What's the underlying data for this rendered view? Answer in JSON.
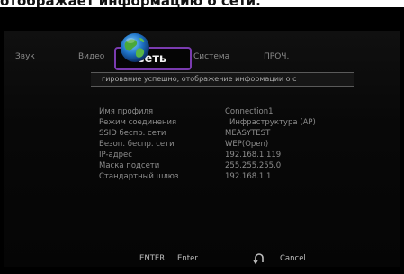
{
  "caption": "отображает информацию о сети.",
  "tabs": [
    {
      "label": "Звук"
    },
    {
      "label": "Видео"
    },
    {
      "label": "Сеть"
    },
    {
      "label": "Система"
    },
    {
      "label": "ПРОЧ."
    }
  ],
  "banner": {
    "text": "гирование успешно, отображение информации о с"
  },
  "info": {
    "rows": [
      {
        "label": "Имя профиля",
        "value": "Connection1"
      },
      {
        "label": "Режим соединения",
        "value": "Инфраструктура (AP)"
      },
      {
        "label": "SSID беспр. сети",
        "value": "MEASYTEST"
      },
      {
        "label": "Безоп. беспр. сети",
        "value": "WEP(Open)"
      },
      {
        "label": "IP-адрес",
        "value": "192.168.1.119"
      },
      {
        "label": "Маска подсети",
        "value": "255.255.255.0"
      },
      {
        "label": "Стандартный шлюз",
        "value": "192.168.1.1"
      }
    ]
  },
  "footer": {
    "enter_key": "ENTER",
    "enter_label": "Enter",
    "cancel_label": "Cancel",
    "return_icon": "return-icon"
  },
  "colors": {
    "active_tab_border": "#7a3bb0",
    "background": "#000000"
  }
}
